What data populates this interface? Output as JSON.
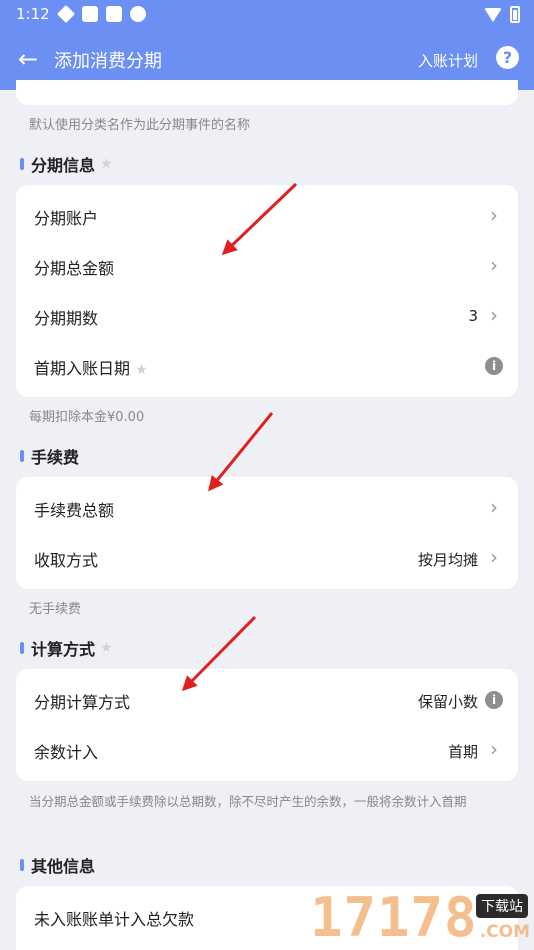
{
  "status_bar": {
    "time": "1:12"
  },
  "app_bar": {
    "title": "添加消费分期",
    "plan_link": "入账计划",
    "help": "?"
  },
  "top": {
    "hint": "默认使用分类名作为此分期事件的名称"
  },
  "installment": {
    "title": "分期信息",
    "rows": [
      {
        "label": "分期账户",
        "value": ""
      },
      {
        "label": "分期总金额",
        "value": ""
      },
      {
        "label": "分期期数",
        "value": "3"
      },
      {
        "label": "首期入账日期",
        "value": ""
      }
    ],
    "hint": "每期扣除本金¥0.00"
  },
  "fee": {
    "title": "手续费",
    "rows": [
      {
        "label": "手续费总额",
        "value": ""
      },
      {
        "label": "收取方式",
        "value": "按月均摊"
      }
    ],
    "hint": "无手续费"
  },
  "calc": {
    "title": "计算方式",
    "rows": [
      {
        "label": "分期计算方式",
        "value": "保留小数"
      },
      {
        "label": "余数计入",
        "value": "首期"
      }
    ],
    "hint": "当分期总金额或手续费除以总期数，除不尽时产生的余数，一般将余数计入首期"
  },
  "other": {
    "title": "其他信息",
    "rows": [
      {
        "label": "未入账账单计入总欠款"
      }
    ]
  },
  "watermark": {
    "digits": "17178",
    "badge": "下载站",
    "sub": ".COM"
  },
  "colors": {
    "accent": "#6b8ff2",
    "arrow": "#e02020",
    "background": "#eef0f6"
  }
}
